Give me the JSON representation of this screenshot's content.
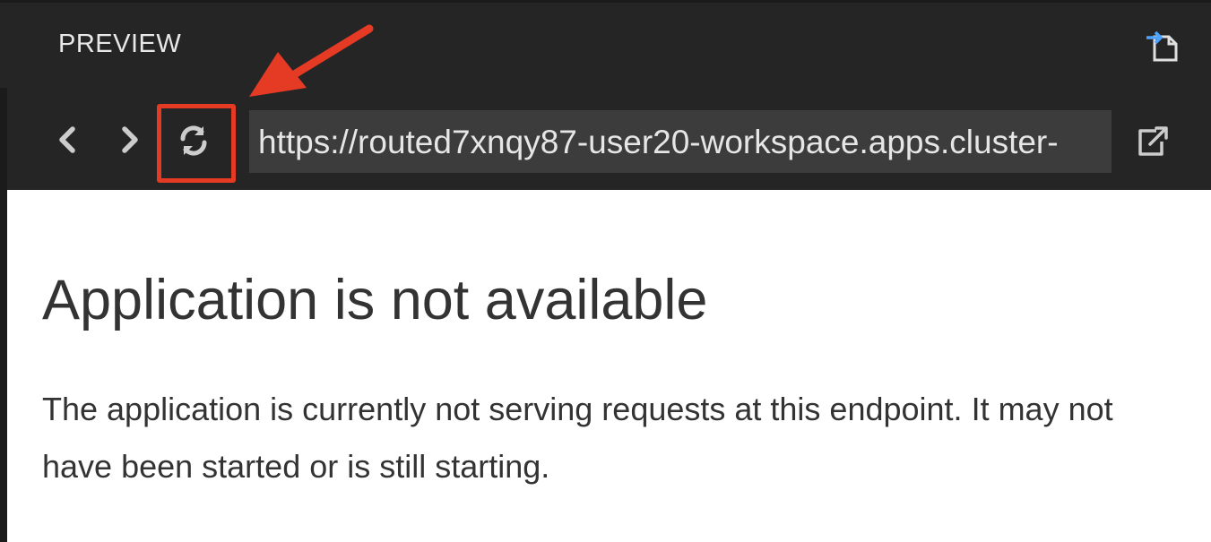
{
  "panel": {
    "title": "PREVIEW",
    "header_action_icon": "open-preview-to-side-icon"
  },
  "toolbar": {
    "back_icon": "chevron-left-icon",
    "forward_icon": "chevron-right-icon",
    "refresh_icon": "refresh-icon",
    "url": "https://routed7xnqy87-user20-workspace.apps.cluster-",
    "external_icon": "external-link-icon"
  },
  "content": {
    "title": "Application is not available",
    "body": "The application is currently not serving requests at this endpoint. It may not have been started or is still starting."
  },
  "annotation": {
    "color": "#e53a24",
    "target": "refresh-button"
  },
  "colors": {
    "panel_bg": "#252526",
    "url_bg": "#3c3c3c",
    "content_bg": "#ffffff",
    "text_dark": "#333333",
    "icon_accent": "#4da3ff"
  }
}
